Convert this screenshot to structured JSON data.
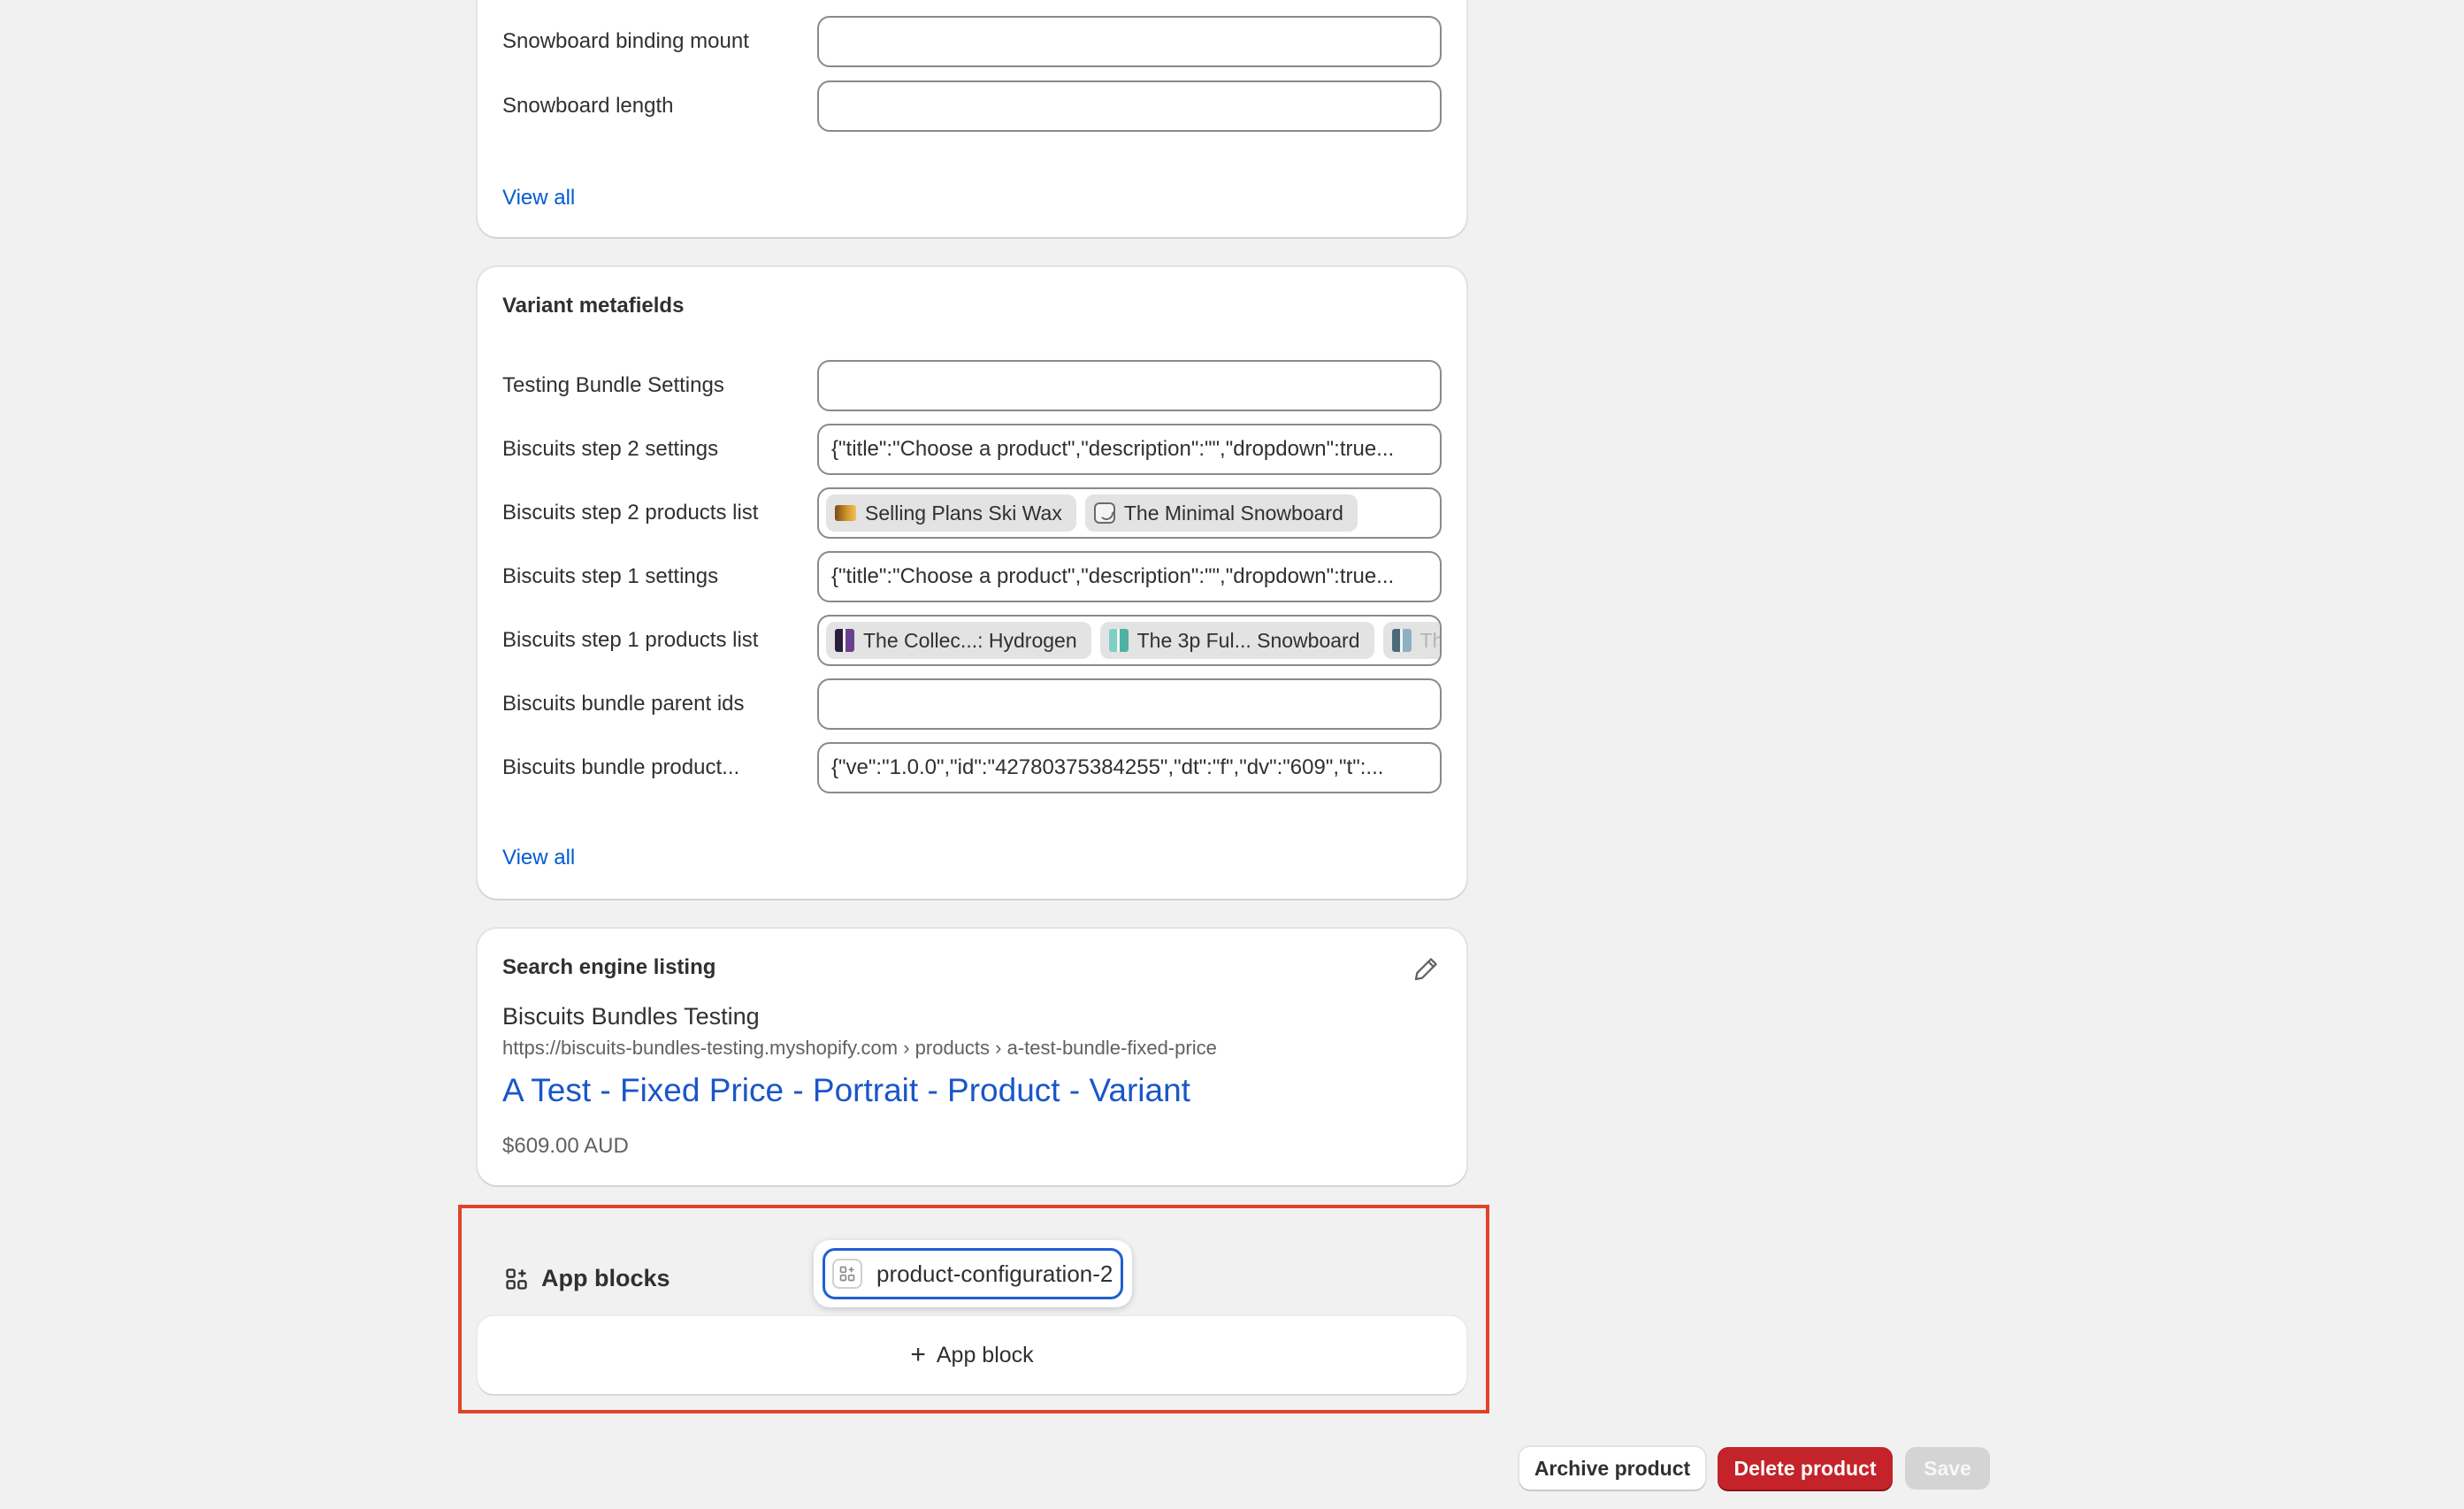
{
  "product_metafields": {
    "rows": [
      {
        "label": "Snowboard binding mount",
        "value": ""
      },
      {
        "label": "Snowboard length",
        "value": ""
      }
    ],
    "view_all": "View all"
  },
  "variant_metafields": {
    "title": "Variant metafields",
    "rows": [
      {
        "label": "Testing Bundle Settings",
        "value": ""
      },
      {
        "label": "Biscuits step 2 settings",
        "value": "{\"title\":\"Choose a product\",\"description\":\"\",\"dropdown\":true..."
      },
      {
        "label": "Biscuits step 2 products list",
        "chips": [
          "Selling Plans Ski Wax",
          "The Minimal Snowboard"
        ]
      },
      {
        "label": "Biscuits step 1 settings",
        "value": "{\"title\":\"Choose a product\",\"description\":\"\",\"dropdown\":true..."
      },
      {
        "label": "Biscuits step 1 products list",
        "chips": [
          "The Collec...: Hydrogen",
          "The 3p Ful... Snowboard",
          "Th"
        ]
      },
      {
        "label": "Biscuits bundle parent ids",
        "value": ""
      },
      {
        "label": "Biscuits bundle product...",
        "value": "{\"ve\":\"1.0.0\",\"id\":\"42780375384255\",\"dt\":\"f\",\"dv\":\"609\",\"t\":..."
      }
    ],
    "view_all": "View all"
  },
  "seo": {
    "title": "Search engine listing",
    "store_name": "Biscuits Bundles Testing",
    "url": "https://biscuits-bundles-testing.myshopify.com › products › a-test-bundle-fixed-price",
    "page_title": "A Test - Fixed Price - Portrait - Product - Variant",
    "price": "$609.00 AUD"
  },
  "app_blocks": {
    "label": "App blocks",
    "block_name": "product-configuration-2",
    "add_label": "App block",
    "highlight_color": "#e0432a"
  },
  "footer": {
    "archive_label": "Archive product",
    "delete_label": "Delete product",
    "save_label": "Save"
  },
  "colors": {
    "link": "#005bd3",
    "danger": "#c4232a",
    "focus": "#1e5fd1"
  }
}
